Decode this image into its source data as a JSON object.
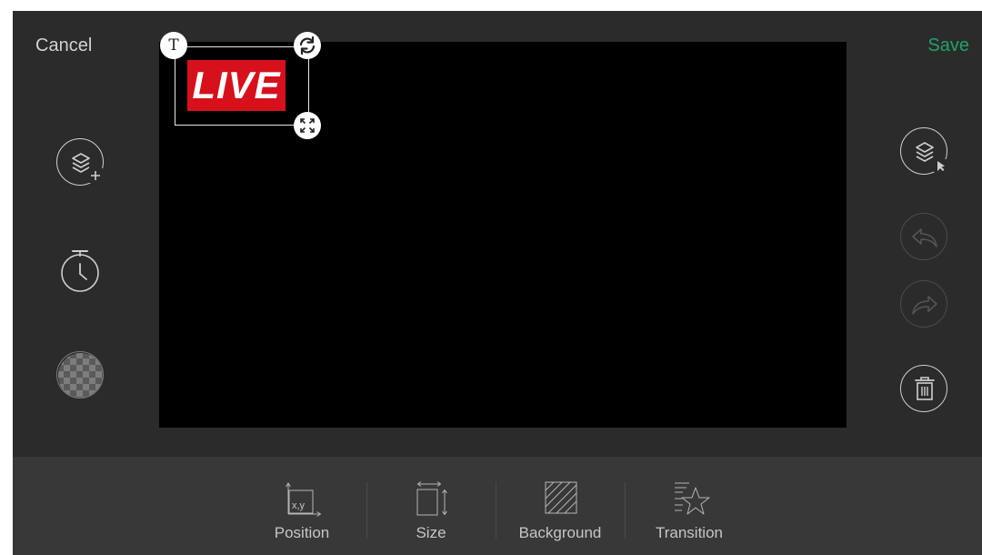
{
  "header": {
    "cancel_label": "Cancel",
    "save_label": "Save"
  },
  "canvas": {
    "sticker": {
      "text": "LIVE",
      "color": "#d7111c"
    },
    "handles": {
      "text_handle_glyph": "T",
      "rotate_icon": "refresh-icon",
      "scale_icon": "expand-icon"
    }
  },
  "left_tools": [
    {
      "icon": "layers-add-icon"
    },
    {
      "icon": "timer-icon"
    },
    {
      "icon": "transparency-icon"
    }
  ],
  "right_tools": [
    {
      "icon": "layers-select-icon",
      "enabled": true
    },
    {
      "icon": "undo-icon",
      "enabled": false
    },
    {
      "icon": "redo-icon",
      "enabled": false
    },
    {
      "icon": "trash-icon",
      "enabled": true
    }
  ],
  "bottom_tools": [
    {
      "label": "Position",
      "icon": "position-icon",
      "icon_text": "x,y"
    },
    {
      "label": "Size",
      "icon": "size-icon"
    },
    {
      "label": "Background",
      "icon": "background-icon"
    },
    {
      "label": "Transition",
      "icon": "transition-icon"
    }
  ],
  "colors": {
    "accent": "#1fa36a",
    "background": "#2b2b2b",
    "toolbar": "#383838",
    "canvas": "#000000"
  }
}
